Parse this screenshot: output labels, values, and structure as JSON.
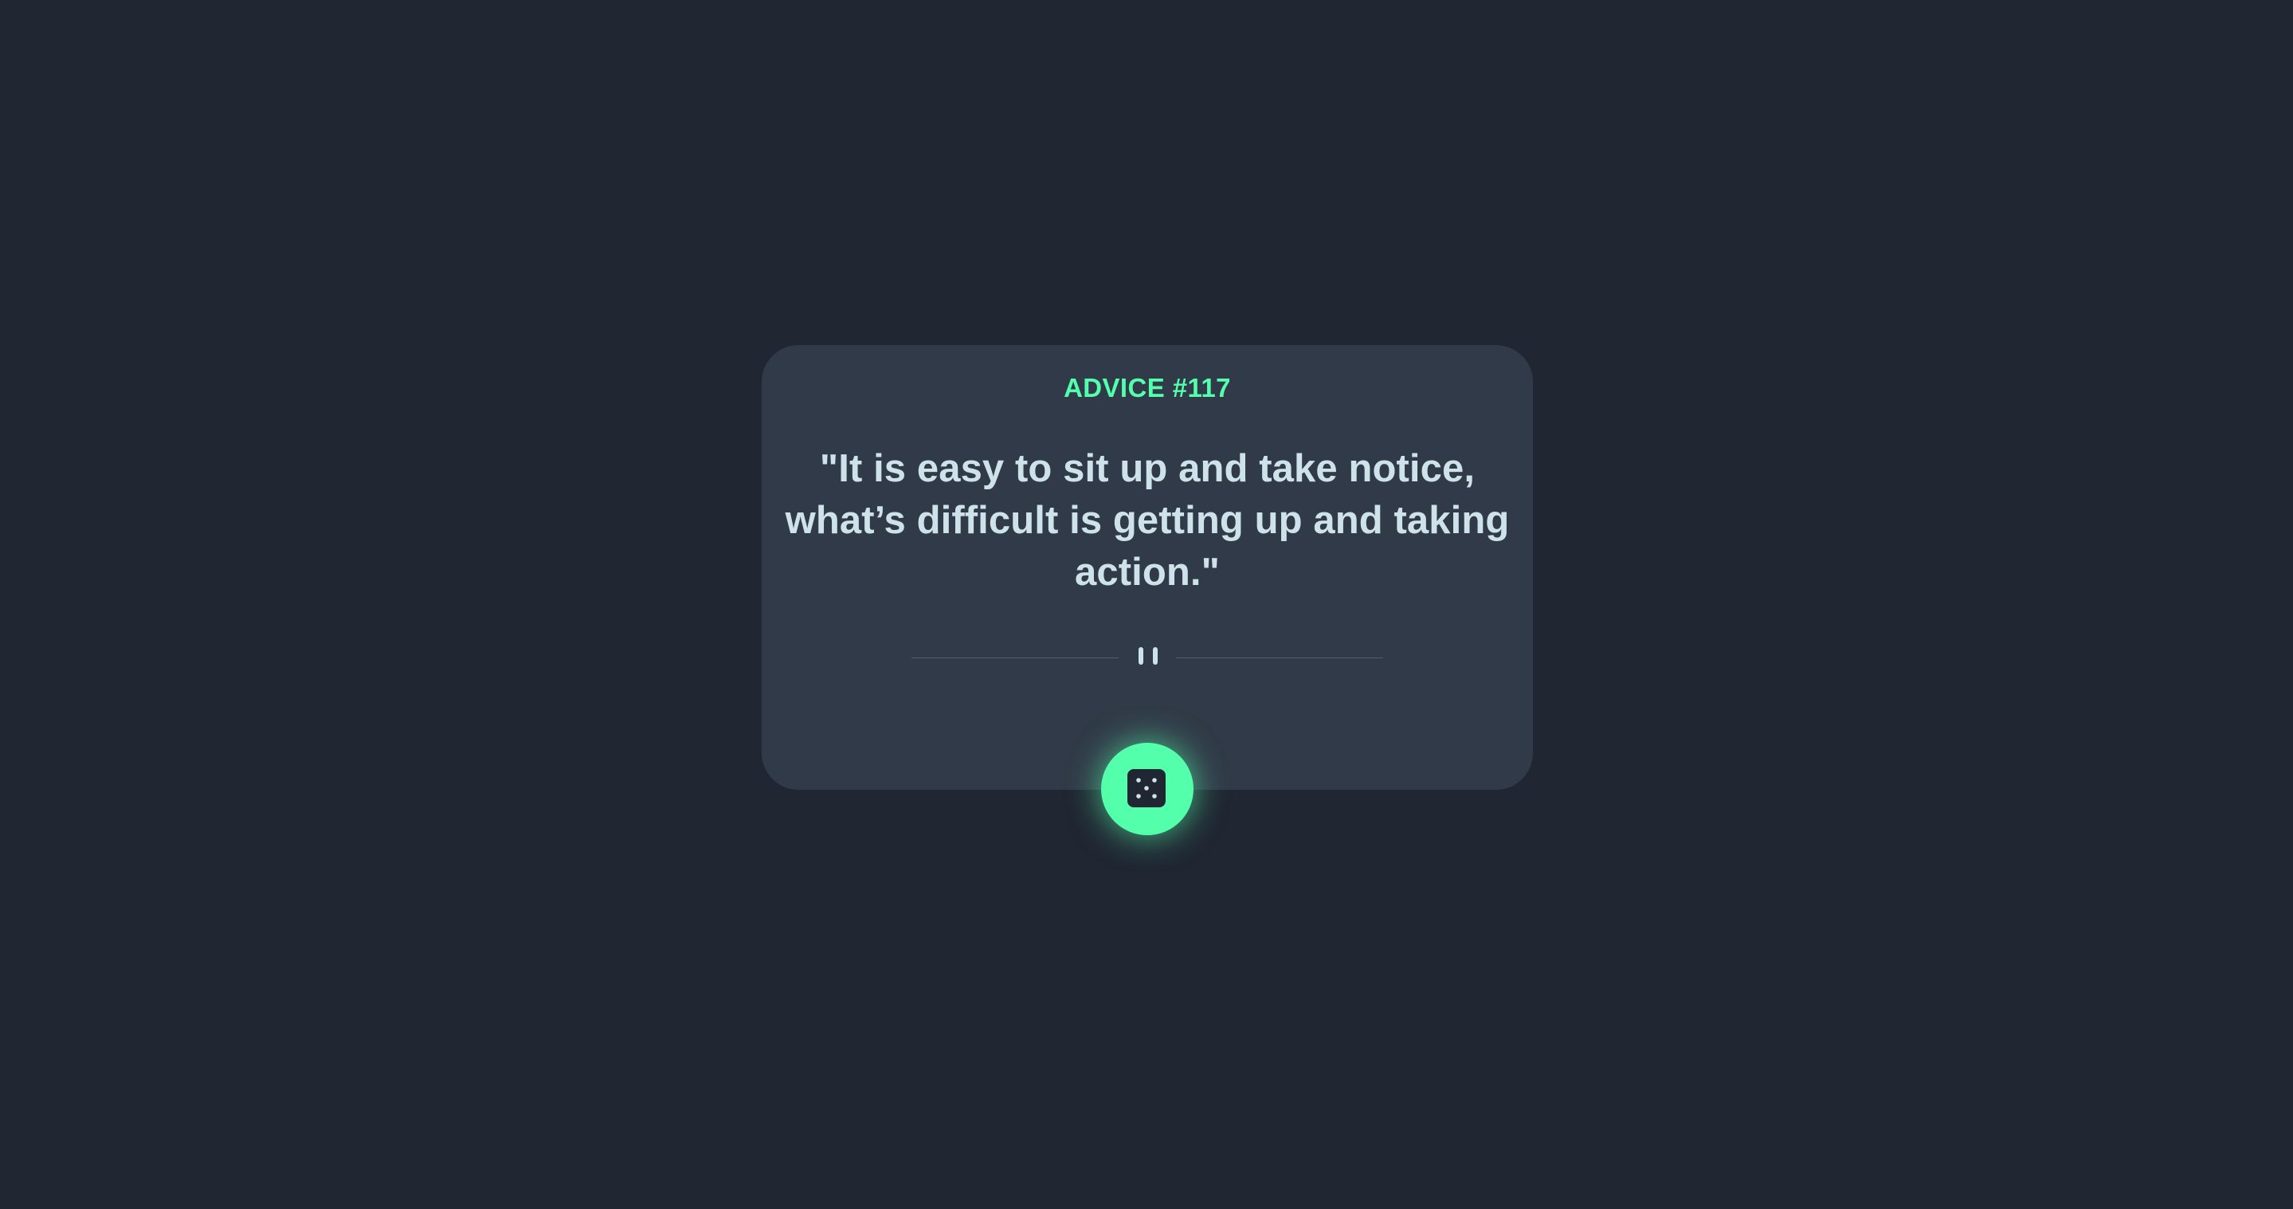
{
  "advice": {
    "heading": "ADVICE #117",
    "quote": "\"It is easy to sit up and take notice, what’s difficult is getting up and taking action.\""
  },
  "icons": {
    "divider": "pause-icon",
    "button": "dice-icon"
  },
  "colors": {
    "background": "#202632",
    "card": "#313a48",
    "accent": "#53ffab",
    "text": "#cee3e9",
    "divider": "#4f5d74",
    "dice": "#202632"
  }
}
